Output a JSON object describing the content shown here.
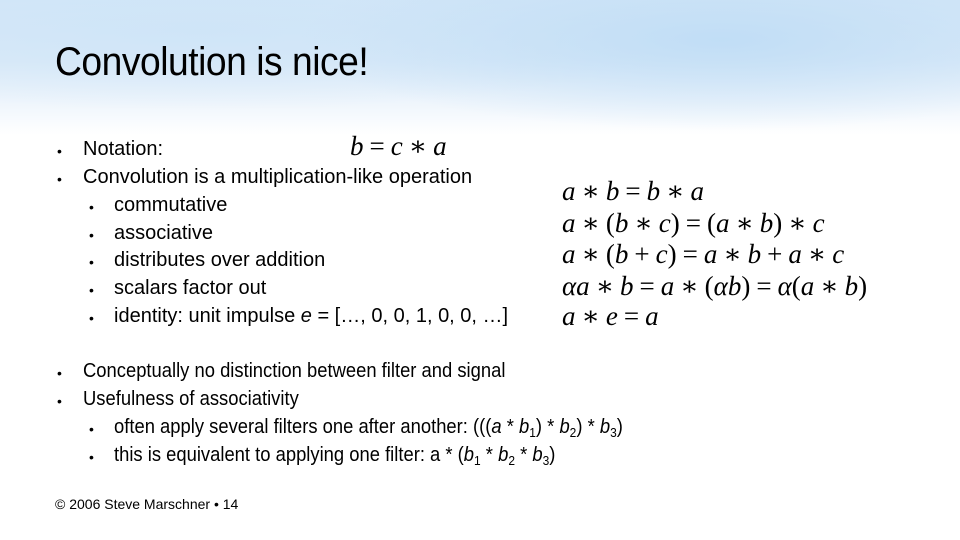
{
  "slide": {
    "title": "Convolution is nice!",
    "bullet_char": "•",
    "notation": {
      "label": "Notation:",
      "formula": "b = c * a"
    },
    "convolution": {
      "label": "Convolution is a multiplication-like operation",
      "properties": [
        {
          "label": "commutative",
          "formula": "a * b = b * a"
        },
        {
          "label": "associative",
          "formula": "a * (b * c) = (a * b) * c"
        },
        {
          "label": "distributes over addition",
          "formula": "a * (b + c) = a * b + a * c"
        },
        {
          "label": "scalars factor out",
          "formula": "αa * b = a * (αb) = α(a * b)"
        },
        {
          "label_prefix": "identity: unit impulse ",
          "label_var": "e",
          "label_suffix": " = […, 0, 0, 1, 0, 0, …]",
          "formula": "a * e = a"
        }
      ]
    },
    "conceptual": "Conceptually no distinction between filter and signal",
    "usefulness": {
      "label": "Usefulness of associativity",
      "items": [
        {
          "text": "often apply several filters one after another: (((a * b1) * b2) * b3)"
        },
        {
          "text": "this is equivalent to applying one filter: a * (b1 * b2 * b3)"
        }
      ]
    },
    "footer": "© 2006 Steve Marschner • 14"
  }
}
